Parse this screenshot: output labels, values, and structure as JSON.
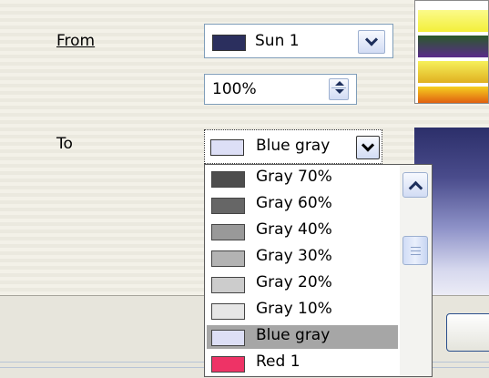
{
  "from": {
    "label": "From",
    "color_value": "Sun 1",
    "color_swatch": "#2b2f5e",
    "percent_value": "100%"
  },
  "to": {
    "label": "To",
    "color_value": "Blue gray",
    "color_swatch": "#dddff6"
  },
  "dropdown": {
    "items": [
      {
        "label": "Gray 70%",
        "swatch": "#4d4d4d",
        "selected": false
      },
      {
        "label": "Gray 60%",
        "swatch": "#666666",
        "selected": false
      },
      {
        "label": "Gray 40%",
        "swatch": "#999999",
        "selected": false
      },
      {
        "label": "Gray 30%",
        "swatch": "#b3b3b3",
        "selected": false
      },
      {
        "label": "Gray 20%",
        "swatch": "#cccccc",
        "selected": false
      },
      {
        "label": "Gray 10%",
        "swatch": "#e6e6e6",
        "selected": false
      },
      {
        "label": "Blue gray",
        "swatch": "#dddff6",
        "selected": true
      },
      {
        "label": "Red 1",
        "swatch": "#ee3366",
        "selected": false
      }
    ]
  }
}
